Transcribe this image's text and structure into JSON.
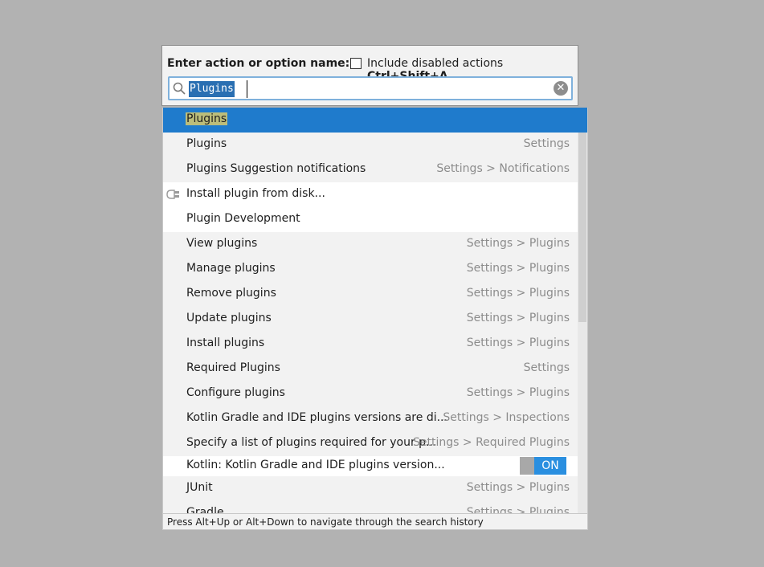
{
  "header": {
    "label": "Enter action or option name:",
    "checkbox_label": "Include disabled actions",
    "checkbox_shortcut": "Ctrl+Shift+A",
    "checkbox_checked": false
  },
  "search": {
    "value": "Plugins"
  },
  "results": [
    {
      "label": "Plugins",
      "location": ""
    },
    {
      "label": "Plugins",
      "location": "Settings"
    },
    {
      "label": "Plugins Suggestion notifications",
      "location": "Settings > Notifications"
    },
    {
      "label": "Install plugin from disk...",
      "location": "",
      "icon": "plug-icon"
    },
    {
      "label": "Plugin Development",
      "location": ""
    },
    {
      "label": "View plugins",
      "location": "Settings > Plugins"
    },
    {
      "label": "Manage plugins",
      "location": "Settings > Plugins"
    },
    {
      "label": "Remove plugins",
      "location": "Settings > Plugins"
    },
    {
      "label": "Update plugins",
      "location": "Settings > Plugins"
    },
    {
      "label": "Install plugins",
      "location": "Settings > Plugins"
    },
    {
      "label": "Required Plugins",
      "location": "Settings"
    },
    {
      "label": "Configure plugins",
      "location": "Settings > Plugins"
    },
    {
      "label": "Kotlin Gradle and IDE plugins versions are di...",
      "location": "Settings > Inspections"
    },
    {
      "label": "Specify a list of plugins required for your p...",
      "location": "Settings > Required Plugins"
    },
    {
      "label": "Kotlin: Kotlin Gradle and IDE plugins version...",
      "toggle": "ON"
    },
    {
      "label": "JUnit",
      "location": "Settings > Plugins"
    },
    {
      "label": "Gradle",
      "location": "Settings > Plugins"
    }
  ],
  "footer": {
    "hint": "Press Alt+Up or Alt+Down to navigate through the search history"
  },
  "colors": {
    "selection": "#1f7bcc",
    "match_highlight": "#bcbd7a",
    "toggle_on": "#2a8fe0"
  }
}
